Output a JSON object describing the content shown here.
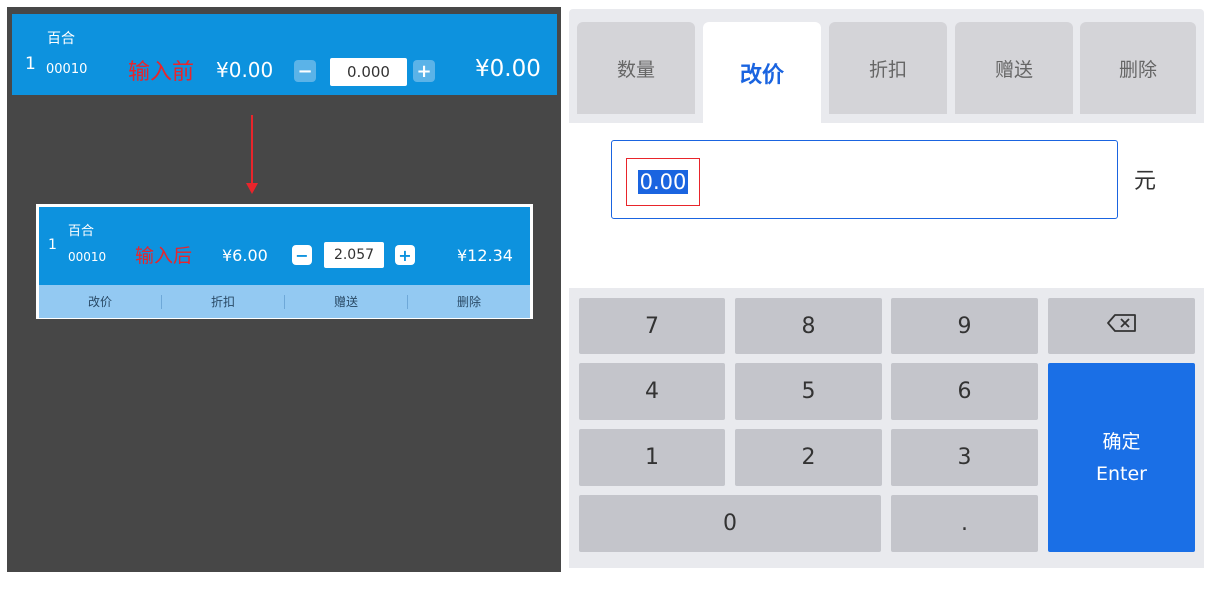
{
  "before_item": {
    "index": "1",
    "name": "百合",
    "code": "00010",
    "note": "输入前",
    "unit_price": "¥0.00",
    "minus": "−",
    "quantity": "0.000",
    "plus": "+",
    "total": "¥0.00"
  },
  "after_item": {
    "index": "1",
    "name": "百合",
    "code": "00010",
    "note": "输入后",
    "unit_price": "¥6.00",
    "minus": "−",
    "quantity": "2.057",
    "plus": "+",
    "total": "¥12.34",
    "actions": [
      "改价",
      "折扣",
      "赠送",
      "删除"
    ]
  },
  "tabs": [
    {
      "label": "数量",
      "active": false
    },
    {
      "label": "改价",
      "active": true
    },
    {
      "label": "折扣",
      "active": false
    },
    {
      "label": "赠送",
      "active": false
    },
    {
      "label": "删除",
      "active": false
    }
  ],
  "price_input": {
    "value": "0.00",
    "unit": "元"
  },
  "keypad": {
    "k7": "7",
    "k8": "8",
    "k9": "9",
    "backspace": "⌫",
    "k4": "4",
    "k5": "5",
    "k6": "6",
    "k1": "1",
    "k2": "2",
    "k3": "3",
    "k0": "0",
    "dot": ".",
    "enter_cn": "确定",
    "enter_en": "Enter"
  },
  "colors": {
    "item_blue": "#0d92de",
    "accent_blue": "#1a64e0",
    "annotation_red": "#e8252b"
  }
}
